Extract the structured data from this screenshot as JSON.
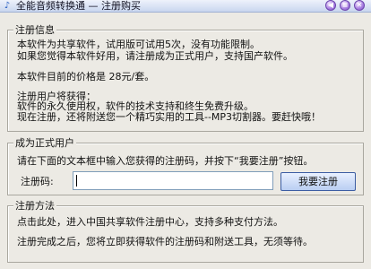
{
  "window": {
    "title": "全能音频转换通 — 注册购买",
    "app_icon": "app-icon",
    "buttons": [
      "◀",
      "≡",
      "✕"
    ]
  },
  "info_section": {
    "title": "注册信息",
    "lines": [
      "本软件为共享软件，试用版可试用5次，没有功能限制。",
      "如果您觉得本软件好用，请注册成为正式用户，支持国产软件。",
      "本软件目前的价格是 28元/套。",
      "注册用户将获得：",
      "软件的永久使用权，软件的技术支持和终生免费升级。",
      "现在注册，还将附送您一个精巧实用的工具--MP3切割器。要赶快哦！"
    ]
  },
  "register_section": {
    "title": "成为正式用户",
    "instruction": "请在下面的文本框中输入您获得的注册码，并按下“我要注册”按钮。",
    "code_label": "注册码:",
    "code_value": "",
    "button_label": "我要注册"
  },
  "method_section": {
    "title": "注册方法",
    "lines": [
      "点击此处，进入中国共享软件注册中心，支持多种支付方法。",
      "注册完成之后，您将立即获得软件的注册码和附送工具，无须等待。"
    ]
  },
  "colors": {
    "window_bg": "#eceae4",
    "titlebar": "#c9d6ef",
    "button_bg": "#b9cdf2",
    "input_border": "#7f9db9"
  }
}
